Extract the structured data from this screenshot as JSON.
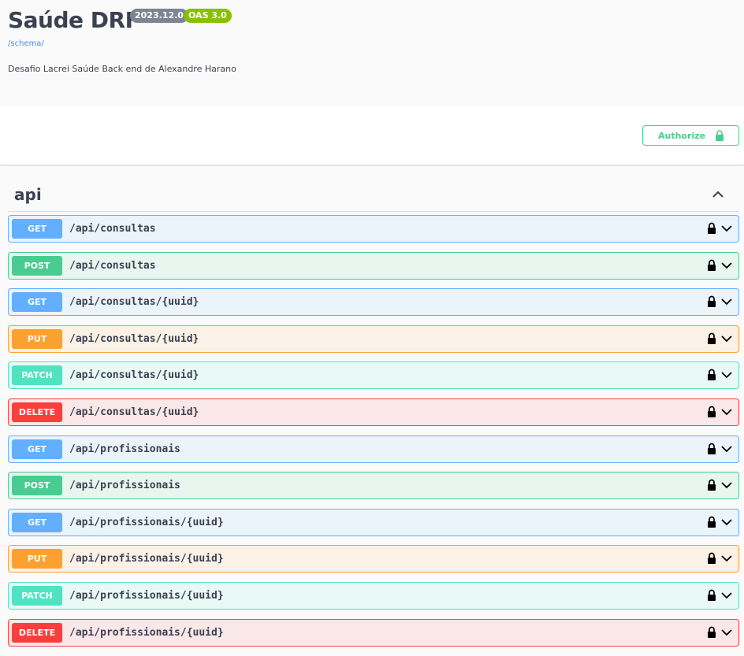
{
  "info": {
    "title": "Saúde DRF",
    "version": "2023.12.0",
    "oas": "OAS 3.0",
    "schema_link": "/schema/",
    "description": "Desafio Lacrei Saúde Back end de Alexandre Harano"
  },
  "authorize": {
    "label": "Authorize",
    "icon": "lock-icon"
  },
  "tag": {
    "name": "api",
    "toggle_icon": "chevron-up-icon"
  },
  "operations": [
    {
      "method": "GET",
      "path": "/api/consultas"
    },
    {
      "method": "POST",
      "path": "/api/consultas"
    },
    {
      "method": "GET",
      "path": "/api/consultas/{uuid}"
    },
    {
      "method": "PUT",
      "path": "/api/consultas/{uuid}"
    },
    {
      "method": "PATCH",
      "path": "/api/consultas/{uuid}"
    },
    {
      "method": "DELETE",
      "path": "/api/consultas/{uuid}"
    },
    {
      "method": "GET",
      "path": "/api/profissionais"
    },
    {
      "method": "POST",
      "path": "/api/profissionais"
    },
    {
      "method": "GET",
      "path": "/api/profissionais/{uuid}"
    },
    {
      "method": "PUT",
      "path": "/api/profissionais/{uuid}"
    },
    {
      "method": "PATCH",
      "path": "/api/profissionais/{uuid}"
    },
    {
      "method": "DELETE",
      "path": "/api/profissionais/{uuid}"
    }
  ],
  "colors": {
    "get": "#61affe",
    "post": "#49cc90",
    "put": "#fca130",
    "patch": "#50e3c2",
    "delete": "#f93e3e"
  }
}
